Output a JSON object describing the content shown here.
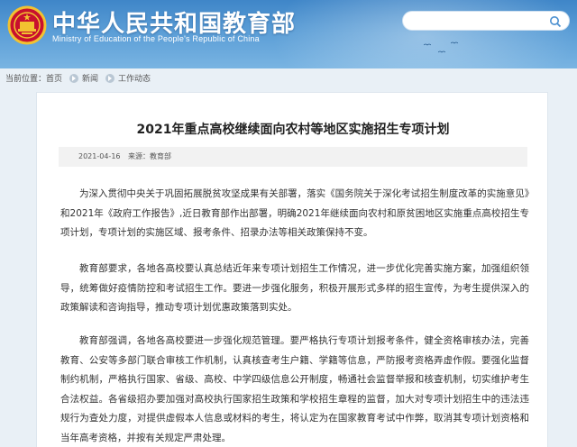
{
  "header": {
    "title": "中华人民共和国教育部",
    "subtitle": "Ministry of Education of the People's Republic of China",
    "search": {
      "placeholder": ""
    }
  },
  "breadcrumb": {
    "prefix": "当前位置：",
    "items": [
      "首页",
      "新闻",
      "工作动态"
    ]
  },
  "article": {
    "title": "2021年重点高校继续面向农村等地区实施招生专项计划",
    "date": "2021-04-16",
    "source": "来源：教育部",
    "paragraphs": [
      "为深入贯彻中央关于巩固拓展脱贫攻坚成果有关部署，落实《国务院关于深化考试招生制度改革的实施意见》和2021年《政府工作报告》,近日教育部作出部署，明确2021年继续面向农村和原贫困地区实施重点高校招生专项计划，专项计划的实施区域、报考条件、招录办法等相关政策保持不变。",
      "教育部要求，各地各高校要认真总结近年来专项计划招生工作情况，进一步优化完善实施方案，加强组织领导，统筹做好疫情防控和考试招生工作。要进一步强化服务，积极开展形式多样的招生宣传，为考生提供深入的政策解读和咨询指导，推动专项计划优惠政策落到实处。",
      "教育部强调，各地各高校要进一步强化规范管理。要严格执行专项计划报考条件，健全资格审核办法，完善教育、公安等多部门联合审核工作机制，认真核查考生户籍、学籍等信息，严防报考资格弄虚作假。要强化监督制约机制，严格执行国家、省级、高校、中学四级信息公开制度，畅通社会监督举报和核查机制，切实维护考生合法权益。各省级招办要加强对高校执行国家招生政策和学校招生章程的监督，加大对专项计划招生中的违法违规行为查处力度，对提供虚假本人信息或材料的考生，将认定为在国家教育考试中作弊，取消其专项计划资格和当年高考资格，并按有关规定严肃处理。"
    ]
  },
  "icons": {
    "emblem": "national-emblem-icon",
    "search": "search-icon",
    "separator": "chevron-right-icon"
  },
  "colors": {
    "header_top": "#3f86c8",
    "header_bottom": "#79b4e2",
    "page_bg": "#e9f0f6"
  }
}
